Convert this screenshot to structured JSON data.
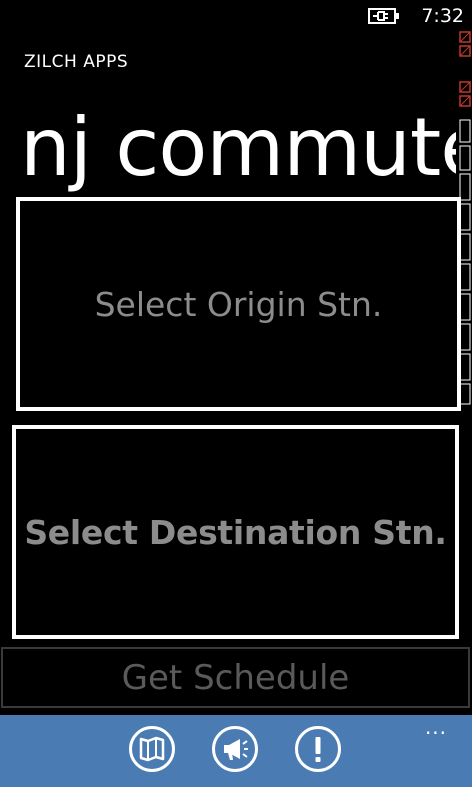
{
  "status_bar": {
    "time": "7:32",
    "battery_icon": "battery-charging-icon"
  },
  "header": {
    "app_name": "ZILCH APPS",
    "page_title": "nj commuter"
  },
  "main": {
    "origin_label": "Select Origin Stn.",
    "destination_label": "Select Destination Stn.",
    "get_schedule_label": "Get Schedule"
  },
  "app_bar": {
    "background": "#4a7cb3",
    "buttons": [
      {
        "icon": "map-icon"
      },
      {
        "icon": "megaphone-icon"
      },
      {
        "icon": "alert-icon"
      }
    ],
    "more_label": "..."
  },
  "colors": {
    "background": "#000000",
    "foreground": "#ffffff",
    "muted_text": "#8c8c8c",
    "disabled_text": "#5a5a5a",
    "accent": "#4a7cb3"
  }
}
